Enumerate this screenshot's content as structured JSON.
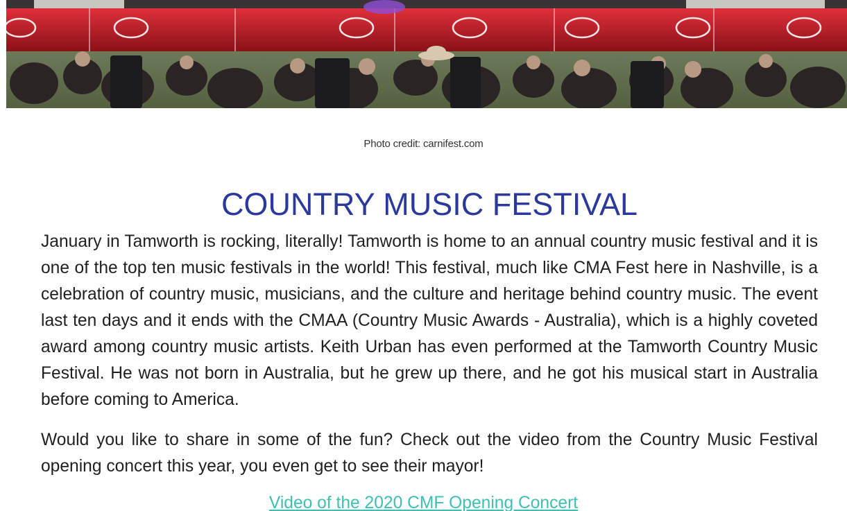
{
  "hero": {
    "brand_color": "#d21f2b",
    "banner_text": "TOYOTA"
  },
  "caption": "Photo credit: carnifest.com",
  "title": "COUNTRY MUSIC FESTIVAL",
  "paragraphs": [
    "January in Tamworth is rocking, literally! Tamworth is home to an annual country music festival and it is one of the top ten music festivals in the world! This festival, much like CMA Fest here in Nashville, is a celebration of country music, musicians, and the culture and heritage behind country music. The event last ten days and it ends with the CMAA (Country Music Awards - Australia), which is a highly coveted award among country music artists. Keith Urban has even performed at the Tamworth Country Music Festival. He was not born in Australia, but he grew up there, and he got his musical start in Australia before coming to America.",
    "Would you like to share in some of the fun? Check out the video from the Country Music Festival opening concert this year, you even get to see their mayor!"
  ],
  "video_link": "Video of the 2020 CMF Opening Concert",
  "colors": {
    "title": "#2b3a9a",
    "link": "#3fbfb0",
    "body_text": "#1f1f1f"
  }
}
